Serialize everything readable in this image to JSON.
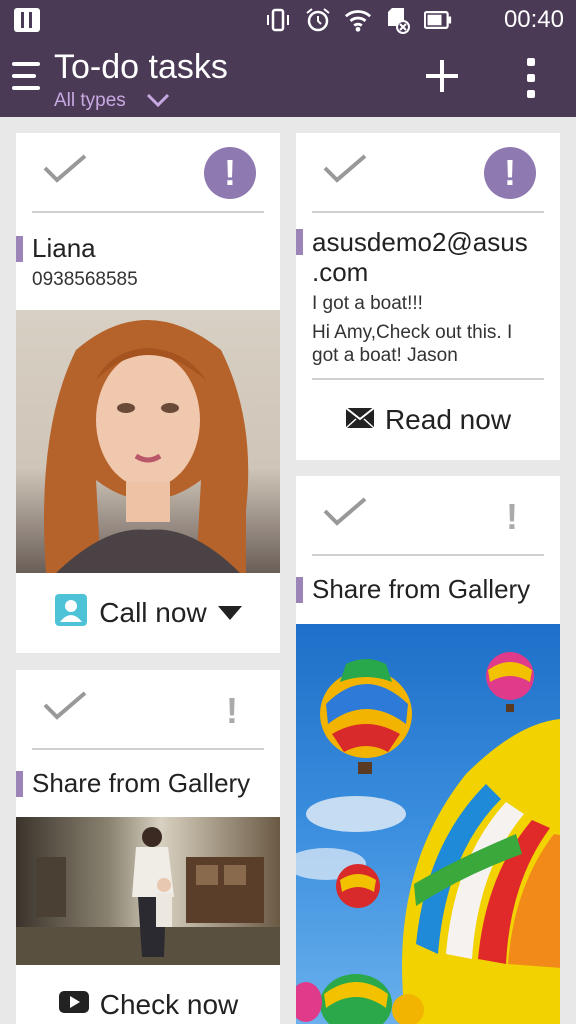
{
  "status_bar": {
    "time": "00:40",
    "icons": [
      "vibrate-icon",
      "alarm-icon",
      "wifi-icon",
      "sd-card-icon",
      "battery-icon"
    ]
  },
  "app_bar": {
    "title": "To-do tasks",
    "filter": "All types"
  },
  "cards": {
    "contact": {
      "name": "Liana",
      "phone": "0938568585",
      "action": "Call now"
    },
    "email": {
      "sender": "asusdemo2@asus.com",
      "sender_line1": "asusdemo2@asus",
      "sender_line2": ".com",
      "subject": "I got a boat!!!",
      "body_line1": "Hi Amy,Check out this. I",
      "body_line2": "got a boat! Jason",
      "action": "Read now"
    },
    "gallery_video": {
      "title": "Share from Gallery",
      "action": "Check now"
    },
    "gallery_image": {
      "title": "Share from Gallery"
    }
  },
  "colors": {
    "bar": "#4a3a56",
    "accent": "#8e79b0",
    "label": "#9c84b8",
    "subtitle": "#c8a8e0"
  }
}
